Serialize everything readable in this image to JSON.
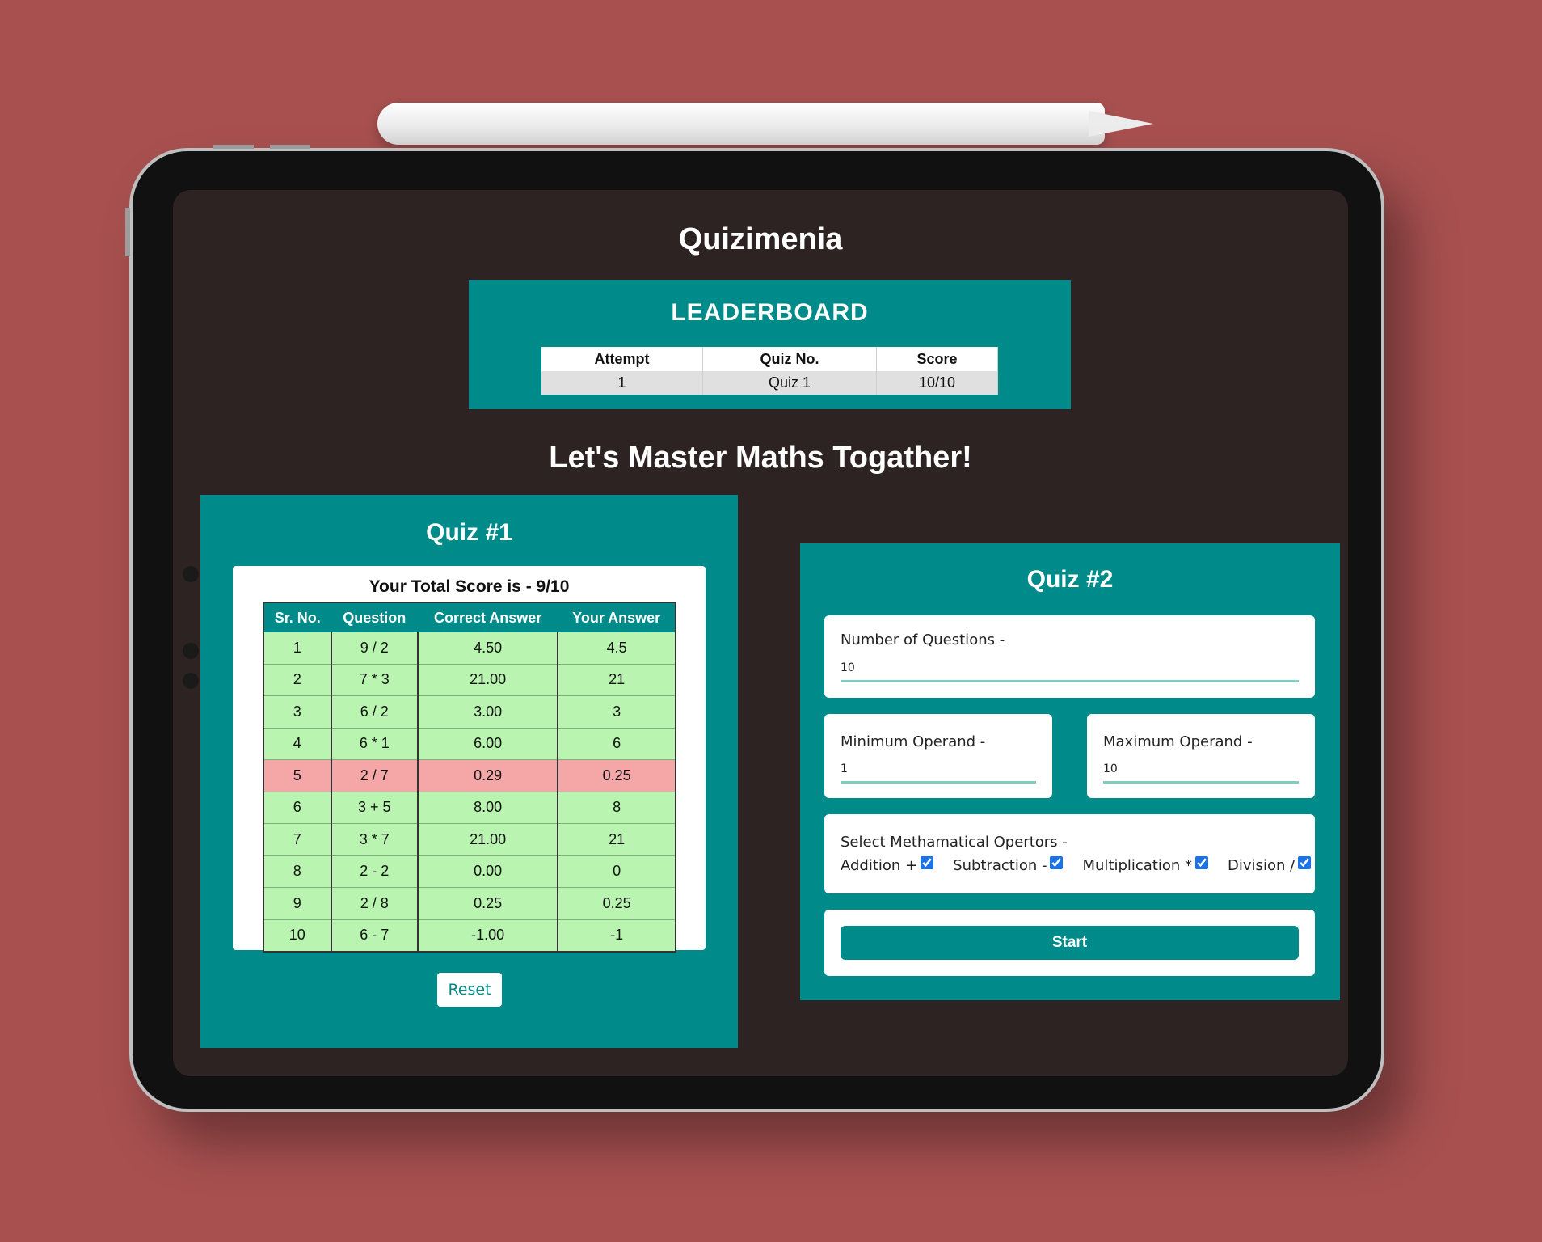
{
  "app": {
    "title": "Quizimenia",
    "tagline": "Let's Master Maths Togather!"
  },
  "leaderboard": {
    "title": "LEADERBOARD",
    "columns": [
      "Attempt",
      "Quiz No.",
      "Score"
    ],
    "rows": [
      {
        "attempt": "1",
        "quiz": "Quiz 1",
        "score": "10/10"
      }
    ]
  },
  "quiz1": {
    "title": "Quiz #1",
    "score_text": "Your Total Score is - 9/10",
    "columns": [
      "Sr. No.",
      "Question",
      "Correct Answer",
      "Your Answer"
    ],
    "rows": [
      {
        "sr": "1",
        "question": "9 / 2",
        "correct": "4.50",
        "answer": "4.5",
        "status": "correct"
      },
      {
        "sr": "2",
        "question": "7 * 3",
        "correct": "21.00",
        "answer": "21",
        "status": "correct"
      },
      {
        "sr": "3",
        "question": "6 / 2",
        "correct": "3.00",
        "answer": "3",
        "status": "correct"
      },
      {
        "sr": "4",
        "question": "6 * 1",
        "correct": "6.00",
        "answer": "6",
        "status": "correct"
      },
      {
        "sr": "5",
        "question": "2 / 7",
        "correct": "0.29",
        "answer": "0.25",
        "status": "wrong"
      },
      {
        "sr": "6",
        "question": "3 + 5",
        "correct": "8.00",
        "answer": "8",
        "status": "correct"
      },
      {
        "sr": "7",
        "question": "3 * 7",
        "correct": "21.00",
        "answer": "21",
        "status": "correct"
      },
      {
        "sr": "8",
        "question": "2 - 2",
        "correct": "0.00",
        "answer": "0",
        "status": "correct"
      },
      {
        "sr": "9",
        "question": "2 / 8",
        "correct": "0.25",
        "answer": "0.25",
        "status": "correct"
      },
      {
        "sr": "10",
        "question": "6 - 7",
        "correct": "-1.00",
        "answer": "-1",
        "status": "correct"
      }
    ],
    "reset_label": "Reset"
  },
  "quiz2": {
    "title": "Quiz #2",
    "num_questions": {
      "label": "Number of Questions -",
      "value": "10"
    },
    "min_operand": {
      "label": "Minimum Operand -",
      "value": "1"
    },
    "max_operand": {
      "label": "Maximum Operand -",
      "value": "10"
    },
    "operators": {
      "label": "Select Methamatical Opertors -",
      "items": [
        {
          "label": "Addition +",
          "checked": true
        },
        {
          "label": "Subtraction -",
          "checked": true
        },
        {
          "label": "Multiplication *",
          "checked": true
        },
        {
          "label": "Division /",
          "checked": true
        }
      ]
    },
    "start_label": "Start"
  },
  "colors": {
    "background": "#a85050",
    "panel": "#008b8b",
    "screen": "#2d2323",
    "correct_row": "#b9f5b0",
    "wrong_row": "#f5a6a6"
  }
}
